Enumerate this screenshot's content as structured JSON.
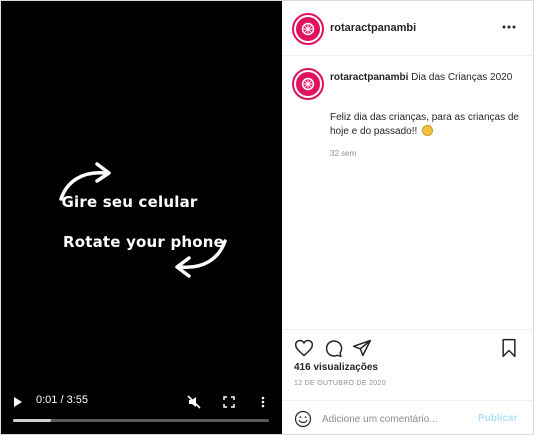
{
  "video": {
    "line1": "Gire seu celular",
    "line2": "Rotate your phone",
    "time": "0:01 / 3:55",
    "progress_fraction": 0.15,
    "icons": [
      "play-icon",
      "mute-icon",
      "fullscreen-icon",
      "more-vertical-icon"
    ]
  },
  "post": {
    "username": "rotaractpanambi",
    "caption_title": "Dia das Crianças 2020",
    "caption_body": "Feliz dia das crianças, para as crianças de hoje e do passado!!",
    "age": "32 sem",
    "views": "416 visualizações",
    "date": "12 DE OUTUBRO DE 2020",
    "comment_placeholder": "Adicione um comentário...",
    "publish_label": "Publicar"
  },
  "colors": {
    "brand": "#e0115f",
    "publish_disabled": "#b2dffc",
    "muted_text": "#8e8e8e"
  }
}
